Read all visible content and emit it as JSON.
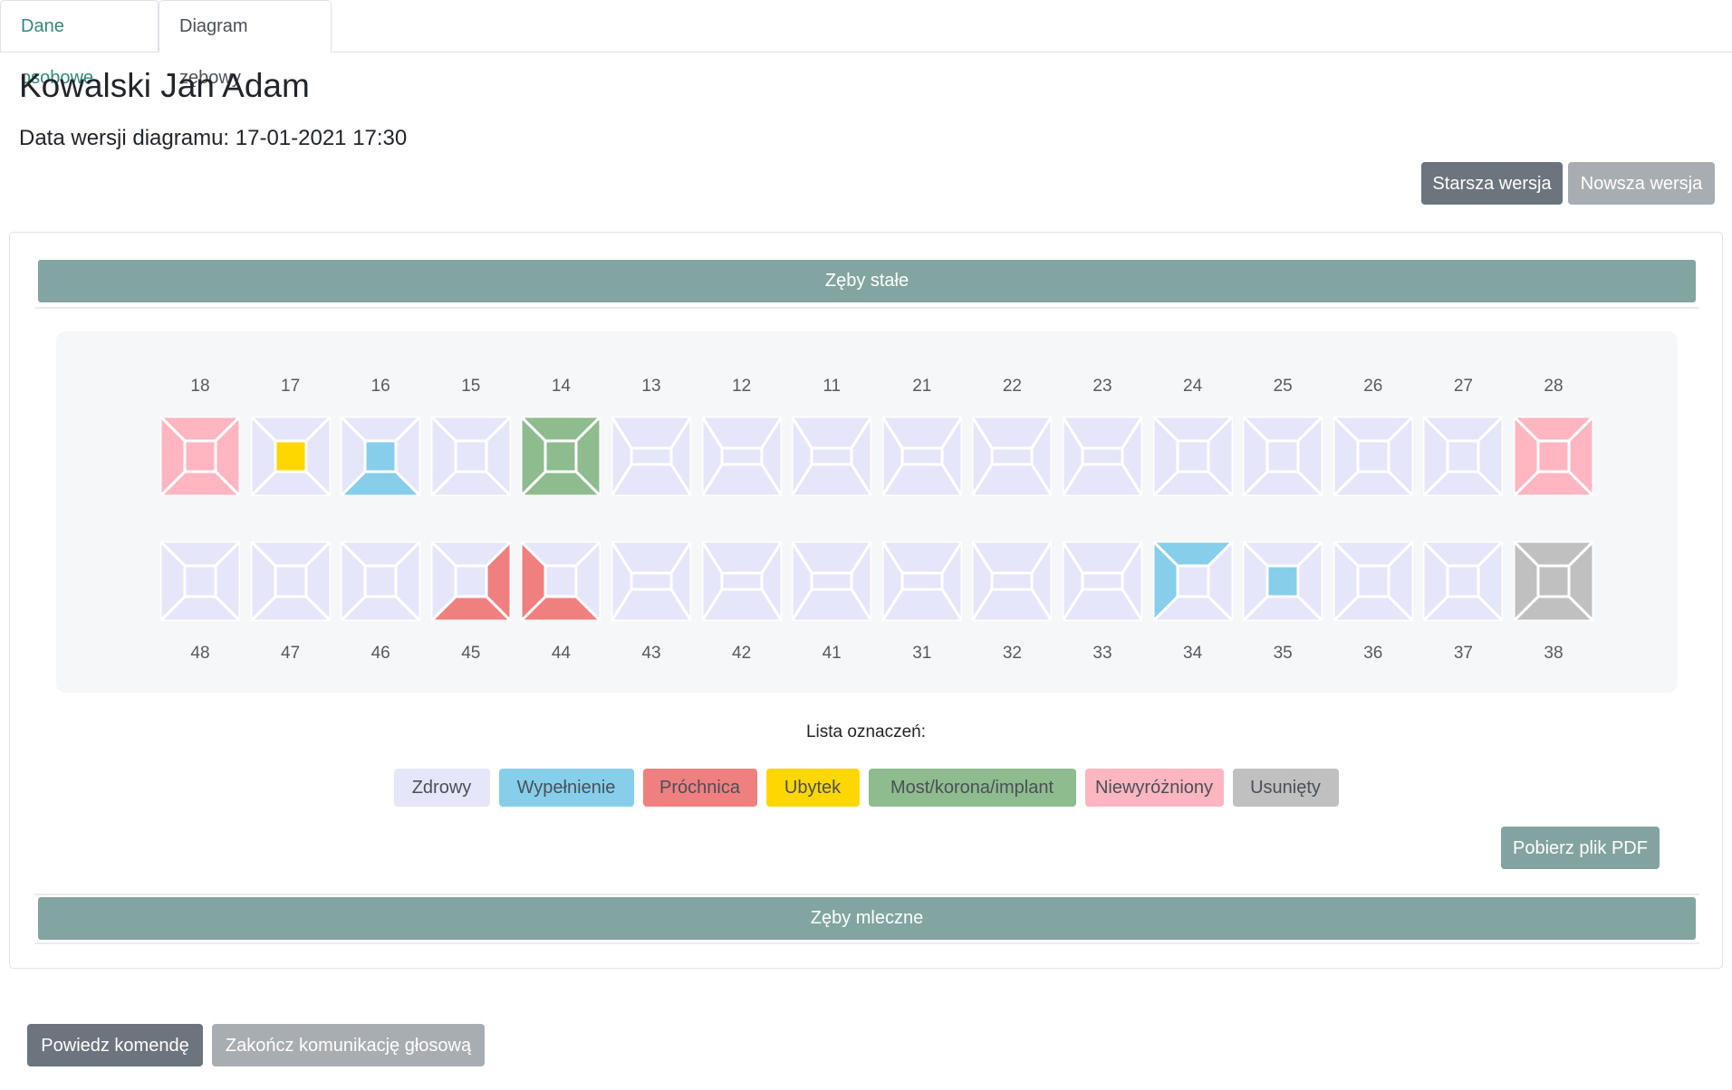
{
  "tabs": {
    "personal": "Dane osobowe",
    "diagram": "Diagram zębowy"
  },
  "patient": {
    "name": "Kowalski Jan Adam",
    "version_date": "Data wersji diagramu: 17-01-2021 17:30"
  },
  "version_nav": {
    "older": "Starsza wersja",
    "newer": "Nowsza wersja"
  },
  "sections": {
    "permanent": "Zęby stałe",
    "milk": "Zęby mleczne"
  },
  "colors": {
    "zdrowy": "#e6e6fa",
    "wypelnienie": "#87ceeb",
    "prochnica": "#f08080",
    "ubytek": "#ffd700",
    "most": "#8fbc8f",
    "niewyrozniony": "#ffb6c1",
    "usuniety": "#c0c0c0",
    "stroke": "#ffffff"
  },
  "teeth": {
    "upper": [
      {
        "number": "18",
        "type": "molar",
        "fill": {
          "top": "niewyrozniony",
          "right": "niewyrozniony",
          "bottom": "niewyrozniony",
          "left": "niewyrozniony",
          "center": "niewyrozniony"
        }
      },
      {
        "number": "17",
        "type": "molar",
        "fill": {
          "center": "ubytek"
        }
      },
      {
        "number": "16",
        "type": "molar",
        "fill": {
          "bottom": "wypelnienie",
          "center": "wypelnienie"
        }
      },
      {
        "number": "15",
        "type": "molar",
        "fill": {}
      },
      {
        "number": "14",
        "type": "molar",
        "fill": {
          "top": "most",
          "right": "most",
          "bottom": "most",
          "left": "most",
          "center": "most"
        }
      },
      {
        "number": "13",
        "type": "incisor",
        "fill": {}
      },
      {
        "number": "12",
        "type": "incisor",
        "fill": {}
      },
      {
        "number": "11",
        "type": "incisor",
        "fill": {}
      },
      {
        "number": "21",
        "type": "incisor",
        "fill": {}
      },
      {
        "number": "22",
        "type": "incisor",
        "fill": {}
      },
      {
        "number": "23",
        "type": "incisor",
        "fill": {}
      },
      {
        "number": "24",
        "type": "molar",
        "fill": {}
      },
      {
        "number": "25",
        "type": "molar",
        "fill": {}
      },
      {
        "number": "26",
        "type": "molar",
        "fill": {}
      },
      {
        "number": "27",
        "type": "molar",
        "fill": {}
      },
      {
        "number": "28",
        "type": "molar",
        "fill": {
          "top": "niewyrozniony",
          "right": "niewyrozniony",
          "bottom": "niewyrozniony",
          "left": "niewyrozniony",
          "center": "niewyrozniony"
        }
      }
    ],
    "lower": [
      {
        "number": "48",
        "type": "molar",
        "fill": {}
      },
      {
        "number": "47",
        "type": "molar",
        "fill": {}
      },
      {
        "number": "46",
        "type": "molar",
        "fill": {}
      },
      {
        "number": "45",
        "type": "molar",
        "fill": {
          "right": "prochnica",
          "bottom": "prochnica"
        }
      },
      {
        "number": "44",
        "type": "molar",
        "fill": {
          "left": "prochnica",
          "bottom": "prochnica"
        }
      },
      {
        "number": "43",
        "type": "incisor",
        "fill": {}
      },
      {
        "number": "42",
        "type": "incisor",
        "fill": {}
      },
      {
        "number": "41",
        "type": "incisor",
        "fill": {}
      },
      {
        "number": "31",
        "type": "incisor",
        "fill": {}
      },
      {
        "number": "32",
        "type": "incisor",
        "fill": {}
      },
      {
        "number": "33",
        "type": "incisor",
        "fill": {}
      },
      {
        "number": "34",
        "type": "molar",
        "fill": {
          "top": "wypelnienie",
          "left": "wypelnienie"
        }
      },
      {
        "number": "35",
        "type": "molar",
        "fill": {
          "center": "wypelnienie"
        }
      },
      {
        "number": "36",
        "type": "molar",
        "fill": {}
      },
      {
        "number": "37",
        "type": "molar",
        "fill": {}
      },
      {
        "number": "38",
        "type": "molar",
        "fill": {
          "top": "usuniety",
          "right": "usuniety",
          "bottom": "usuniety",
          "left": "usuniety",
          "center": "usuniety"
        }
      }
    ]
  },
  "legend": {
    "title": "Lista oznaczeń:",
    "items": [
      {
        "label": "Zdrowy",
        "color": "zdrowy"
      },
      {
        "label": "Wypełnienie",
        "color": "wypelnienie"
      },
      {
        "label": "Próchnica",
        "color": "prochnica"
      },
      {
        "label": "Ubytek",
        "color": "ubytek"
      },
      {
        "label": "Most/korona/implant",
        "color": "most"
      },
      {
        "label": "Niewyróżniony",
        "color": "niewyrozniony"
      },
      {
        "label": "Usunięty",
        "color": "usuniety"
      }
    ]
  },
  "actions": {
    "download_pdf": "Pobierz plik PDF",
    "say_command": "Powiedz komendę",
    "end_voice": "Zakończ komunikację głosową"
  }
}
